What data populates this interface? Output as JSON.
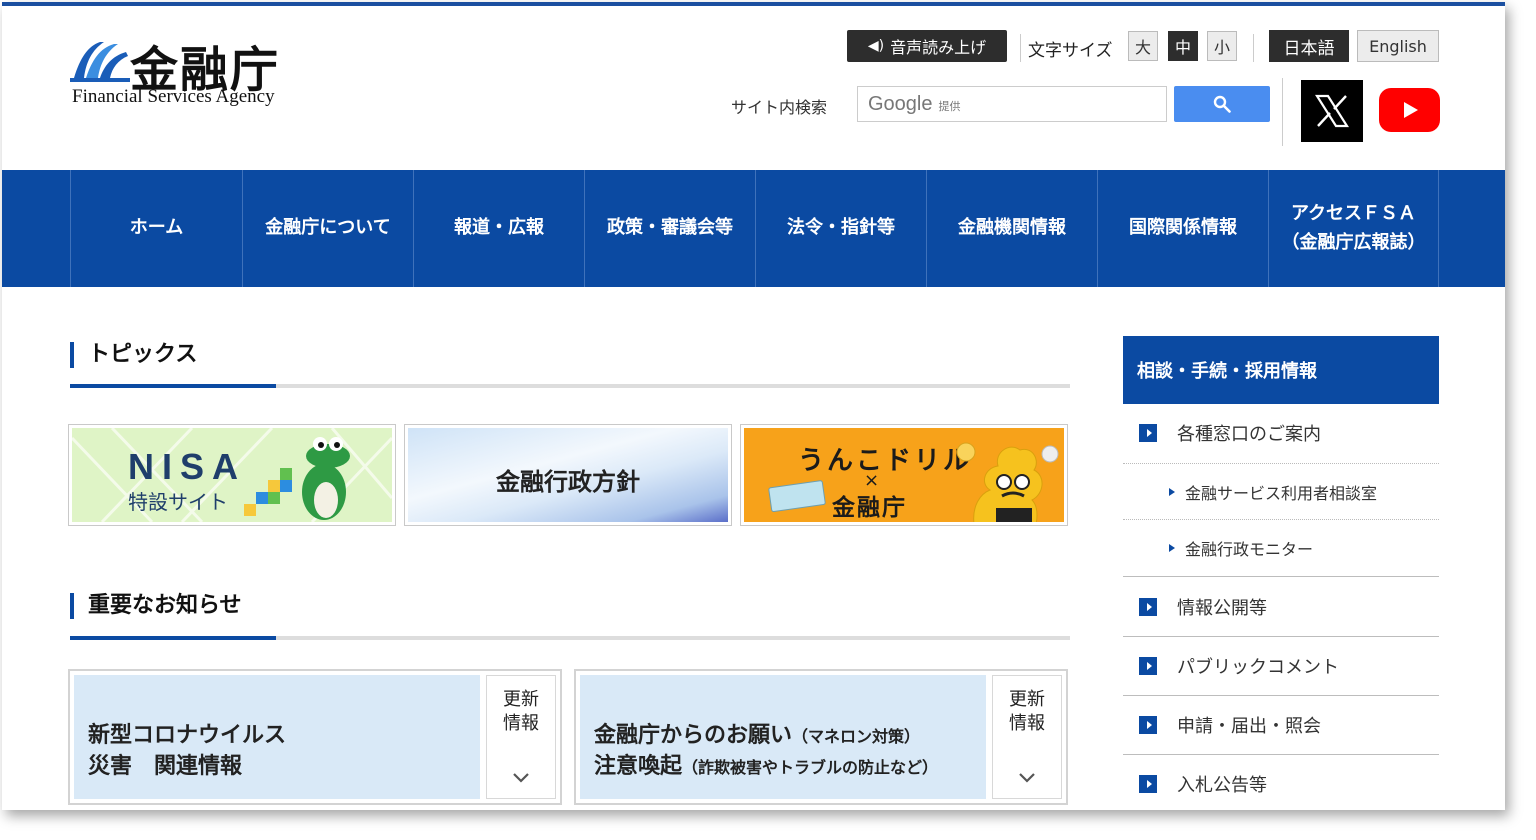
{
  "colors": {
    "brand_blue": "#0b4aa2",
    "search_blue": "#4a8df0",
    "youtube_red": "#ff0000"
  },
  "header": {
    "logo_jp": "金融庁",
    "logo_en": "Financial Services Agency",
    "speak_label": "音声読み上げ",
    "font_size_label": "文字サイズ",
    "font_sizes": [
      "大",
      "中",
      "小"
    ],
    "font_size_selected": "中",
    "lang_jp": "日本語",
    "lang_en": "English",
    "search_label": "サイト内検索",
    "search_brand": "Google",
    "search_brand_suffix": "提供"
  },
  "nav": {
    "items": [
      "ホーム",
      "金融庁について",
      "報道・広報",
      "政策・審議会等",
      "法令・指針等",
      "金融機関情報",
      "国際関係情報",
      "アクセスＦＳＡ\n（金融庁広報誌）"
    ]
  },
  "topics": {
    "title": "トピックス",
    "banners": {
      "nisa_title": "NISA",
      "nisa_sub": "特設サイト",
      "policy": "金融行政方針",
      "unko_top": "うんこドリル",
      "unko_x": "×",
      "unko_bottom": "金融庁"
    }
  },
  "notices": {
    "title": "重要なお知らせ",
    "cards": [
      {
        "line1": "新型コロナウイルス",
        "line2": "災害　関連情報",
        "line1_note": "",
        "line2_note": "",
        "update": "更新\n情報"
      },
      {
        "line1": "金融庁からのお願い",
        "line1_note": "（マネロン対策）",
        "line2": "注意喚起",
        "line2_note": "（詐欺被害やトラブルの防止など）",
        "update": "更新\n情報"
      }
    ]
  },
  "sidebar": {
    "header": "相談・手続・採用情報",
    "items": [
      "各種窓口のご案内",
      "金融サービス利用者相談室",
      "金融行政モニター",
      "情報公開等",
      "パブリックコメント",
      "申請・届出・照会",
      "入札公告等"
    ]
  }
}
